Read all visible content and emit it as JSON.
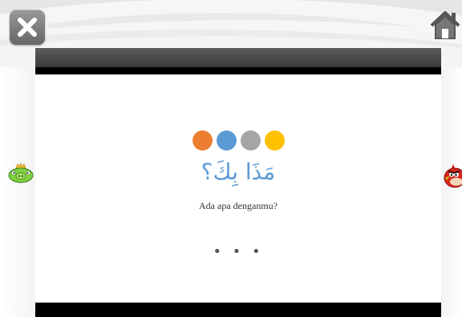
{
  "toolbar": {
    "close_icon": "close-x-icon",
    "home_icon": "home-icon"
  },
  "slide": {
    "dot_colors": [
      "#ed7d31",
      "#5b9bd5",
      "#a5a5a5",
      "#ffc000"
    ],
    "arabic_text": "مَذَا بِكَ؟",
    "translation": "Ada apa denganmu?",
    "more_indicator": "• • •",
    "arabic_color": "#5b9bd5"
  },
  "navigation": {
    "prev_icon": "green-pig-icon",
    "next_icon": "red-angry-bird-icon"
  }
}
